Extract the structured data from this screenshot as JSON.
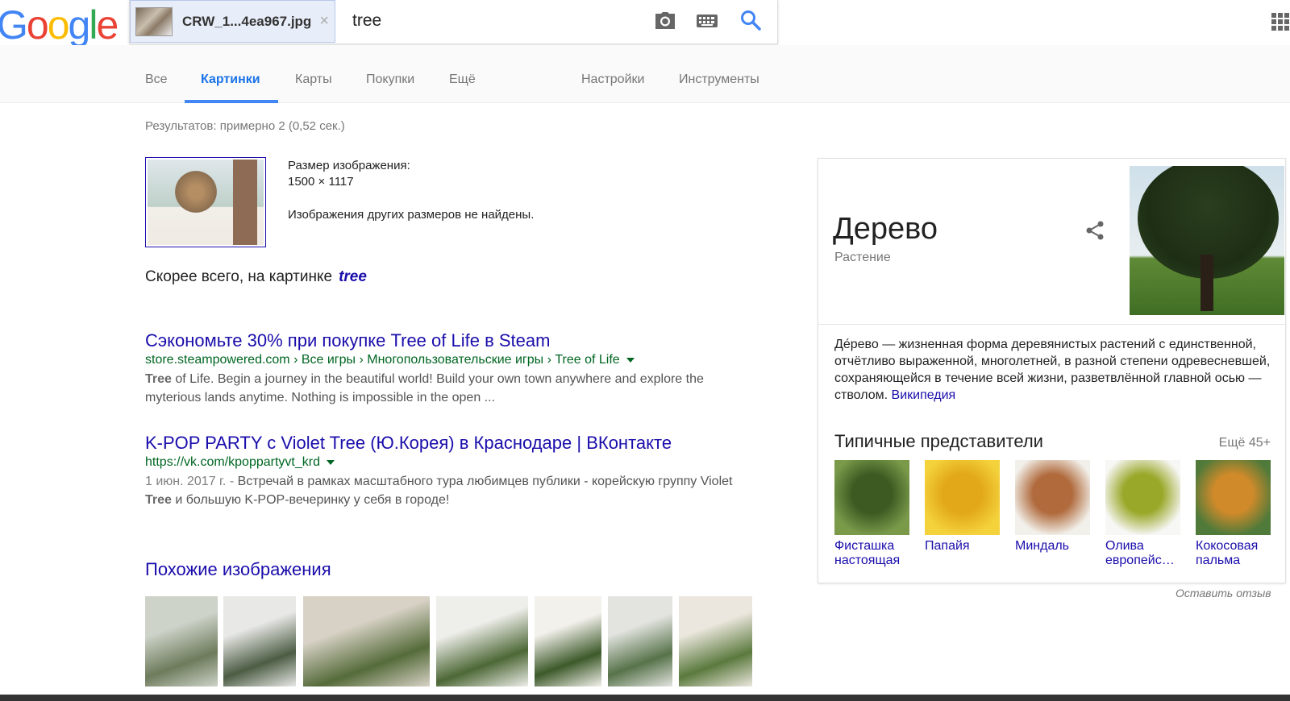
{
  "logo": {
    "letters": [
      "G",
      "o",
      "o",
      "g",
      "l",
      "e"
    ],
    "colors": [
      "#4285f4",
      "#ea4335",
      "#fbbc05",
      "#4285f4",
      "#34a853",
      "#ea4335"
    ]
  },
  "search": {
    "chip_name": "CRW_1...4ea967.jpg",
    "chip_close": "×",
    "query": "tree",
    "icons": [
      "camera-icon",
      "keyboard-icon",
      "search-icon"
    ]
  },
  "tabs": [
    {
      "label": "Все",
      "active": false
    },
    {
      "label": "Картинки",
      "active": true
    },
    {
      "label": "Карты",
      "active": false
    },
    {
      "label": "Покупки",
      "active": false
    },
    {
      "label": "Ещё",
      "active": false
    },
    {
      "label": "Настройки",
      "active": false
    },
    {
      "label": "Инструменты",
      "active": false
    }
  ],
  "stats": "Результатов: примерно 2 (0,52 сек.)",
  "image_info": {
    "size_label": "Размер изображения:",
    "size_value": "1500 × 1117",
    "no_other": "Изображения других размеров не найдены."
  },
  "best_guess": {
    "prefix": "Скорее всего, на картинке",
    "term": "tree"
  },
  "results": [
    {
      "title": "Сэкономьте 30% при покупке Tree of Life в Steam",
      "url": "store.steampowered.com › Все игры › Многопользовательские игры › Tree of Life",
      "snippet_bold": "Tree",
      "snippet": " of Life. Begin a journey in the beautiful world! Build your own town anywhere and explore the myterious lands anytime. Nothing is impossible in the open ..."
    },
    {
      "title": "K-POP PARTY с Violet Tree (Ю.Корея) в Краснодаре | ВКонтакте",
      "url": "https://vk.com/kpoppartyvt_krd",
      "date": "1 июн. 2017 г. - ",
      "snippet_a": "Встречай в рамках масштабного тура любимцев публики - корейскую группу Violet ",
      "snippet_bold": "Tree",
      "snippet_b": " и большую K-POP-вечеринку у себя в городе!"
    }
  ],
  "similar": {
    "title": "Похожие изображения",
    "thumbs": [
      {
        "colors": [
          "#cdd3c9",
          "#6e7b5c"
        ]
      },
      {
        "colors": [
          "#e8e8e6",
          "#4c5d44"
        ]
      },
      {
        "colors": [
          "#d8d2c6",
          "#556b3a"
        ]
      },
      {
        "colors": [
          "#eeeeea",
          "#4d6836"
        ]
      },
      {
        "colors": [
          "#f3f1ec",
          "#3d5a2a"
        ]
      },
      {
        "colors": [
          "#e3e4e0",
          "#57734a"
        ]
      },
      {
        "colors": [
          "#ece7de",
          "#5b7a3e"
        ]
      }
    ]
  },
  "knowledge_panel": {
    "title": "Дерево",
    "subtitle": "Растение",
    "description": "Де́рево — жизненная форма деревянистых растений с единственной, отчётливо выраженной, многолетней, в разной степени одревесневшей, сохраняющейся в течение всей жизни, разветвлённой главной осью — стволом.",
    "source": "Википедия",
    "section_title": "Типичные представители",
    "more": "Ещё 45+",
    "items": [
      {
        "label": "Фисташка настоящая",
        "colors": [
          "#7a9a4a",
          "#3d5a22"
        ]
      },
      {
        "label": "Папайя",
        "colors": [
          "#f4d23c",
          "#e2a81a"
        ]
      },
      {
        "label": "Миндаль",
        "colors": [
          "#f2f0ea",
          "#b06a3c"
        ]
      },
      {
        "label": "Олива европейс…",
        "colors": [
          "#f7f7f5",
          "#9aa82a"
        ]
      },
      {
        "label": "Кокосовая пальма",
        "colors": [
          "#4f7a3a",
          "#d08a2a"
        ]
      }
    ]
  },
  "feedback": "Оставить отзыв"
}
